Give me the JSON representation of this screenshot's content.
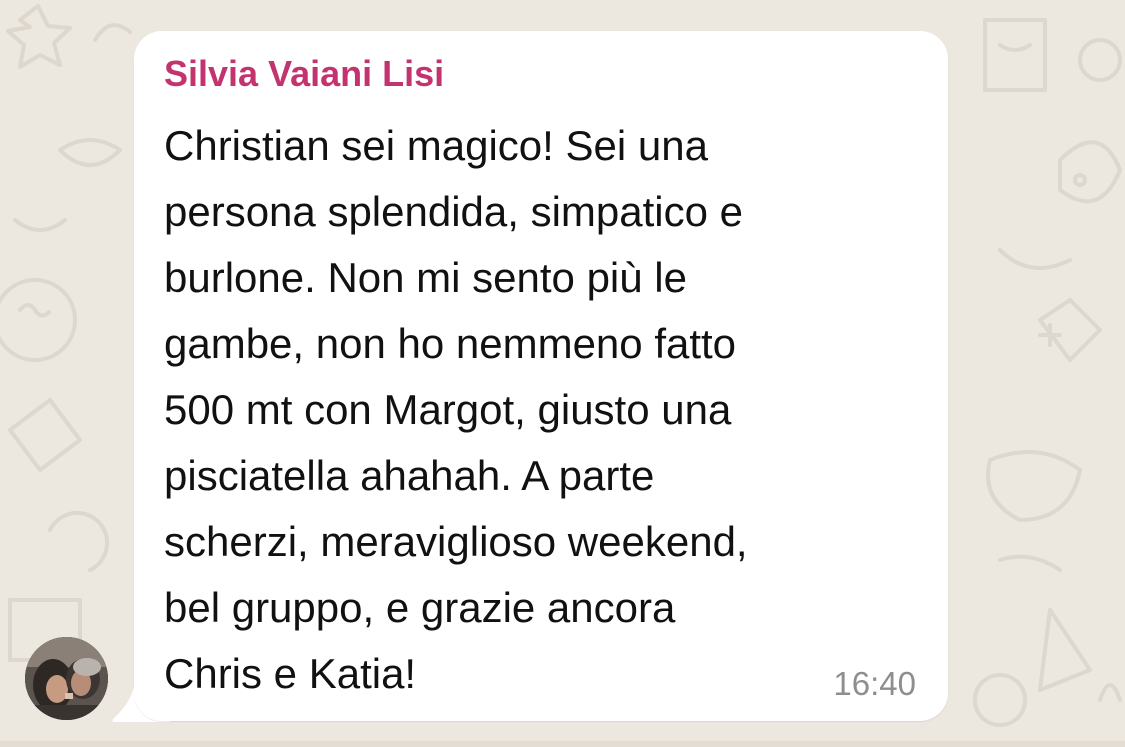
{
  "chat": {
    "sender_name": "Silvia Vaiani Lisi",
    "message_lines": [
      "Christian sei magico! Sei una",
      "persona splendida, simpatico e",
      "burlone. Non mi sento più le",
      "gambe, non ho nemmeno fatto",
      "500 mt con Margot, giusto una",
      "pisciatella ahahah. A parte",
      "scherzi, meraviglioso weekend,",
      "bel gruppo, e grazie ancora",
      "Chris e Katia!"
    ],
    "timestamp": "16:40",
    "avatar_icon": "sender-avatar-photo"
  },
  "colors": {
    "wallpaper": "#ece7df",
    "bubble": "#ffffff",
    "sender_name": "#c2336f",
    "text": "#111111",
    "timestamp": "#8e8e8e"
  }
}
